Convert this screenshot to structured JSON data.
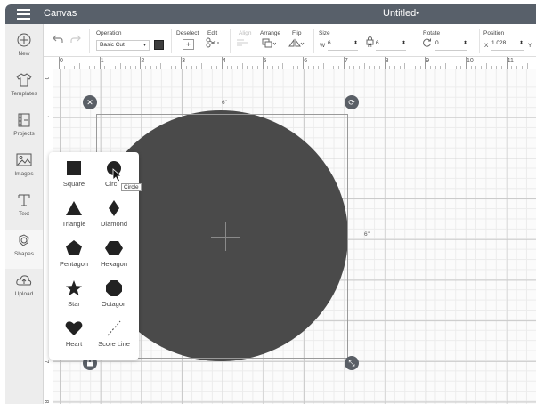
{
  "app": {
    "title": "Canvas",
    "document_title": "Untitled•"
  },
  "nav": [
    {
      "label": "New",
      "icon": "plus-circle-icon"
    },
    {
      "label": "Templates",
      "icon": "shirt-icon"
    },
    {
      "label": "Projects",
      "icon": "projects-icon"
    },
    {
      "label": "Images",
      "icon": "image-icon"
    },
    {
      "label": "Text",
      "icon": "text-icon"
    },
    {
      "label": "Shapes",
      "icon": "shapes-icon"
    },
    {
      "label": "Upload",
      "icon": "upload-cloud-icon"
    }
  ],
  "toolbar": {
    "operation_label": "Operation",
    "operation_value": "Basic Cut",
    "operation_color": "#3d3d3d",
    "deselect_label": "Deselect",
    "edit_label": "Edit",
    "align_label": "Align",
    "arrange_label": "Arrange",
    "flip_label": "Flip",
    "size_label": "Size",
    "w_label": "W",
    "w_value": "6",
    "h_label": "H",
    "h_value": "6",
    "rotate_label": "Rotate",
    "rotate_value": "0",
    "position_label": "Position",
    "x_label": "X",
    "x_value": "1.028",
    "y_label": "Y"
  },
  "ruler": {
    "top": [
      "0",
      "1",
      "2",
      "3",
      "4",
      "5",
      "6",
      "7",
      "8",
      "9",
      "10",
      "11"
    ],
    "left": [
      "0",
      "1",
      "7",
      "8"
    ]
  },
  "canvas": {
    "width_label": "6\"",
    "height_label": "6\"",
    "shape_color": "#4a4a4a"
  },
  "shapes_panel": {
    "items": [
      {
        "label": "Square",
        "icon": "square-icon"
      },
      {
        "label": "Circle",
        "icon": "circle-icon"
      },
      {
        "label": "Triangle",
        "icon": "triangle-icon"
      },
      {
        "label": "Diamond",
        "icon": "diamond-icon"
      },
      {
        "label": "Pentagon",
        "icon": "pentagon-icon"
      },
      {
        "label": "Hexagon",
        "icon": "hexagon-icon"
      },
      {
        "label": "Star",
        "icon": "star-icon"
      },
      {
        "label": "Octagon",
        "icon": "octagon-icon"
      },
      {
        "label": "Heart",
        "icon": "heart-icon"
      },
      {
        "label": "Score Line",
        "icon": "score-line-icon"
      }
    ],
    "tooltip": "Circle",
    "circle_label_visible": "Circ"
  }
}
